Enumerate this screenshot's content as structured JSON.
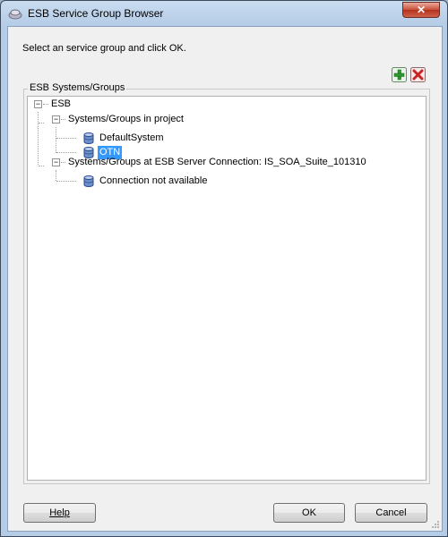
{
  "window": {
    "title": "ESB Service Group Browser",
    "close_symbol": "✕",
    "title_icon": "esb-app-icon"
  },
  "dialog": {
    "instruction": "Select an service group and click OK.",
    "add_icon": "add-icon",
    "delete_icon": "delete-icon",
    "group_label": "ESB Systems/Groups"
  },
  "tree": {
    "root": {
      "label": "ESB",
      "expanded": true
    },
    "project": {
      "label": "Systems/Groups in project",
      "expanded": true,
      "items": [
        "DefaultSystem",
        "OTN"
      ],
      "selected": "OTN"
    },
    "server": {
      "label": "Systems/Groups at ESB Server Connection: IS_SOA_Suite_101310",
      "expanded": true,
      "items": [
        "Connection not available"
      ]
    },
    "expander_symbol": "−"
  },
  "buttons": {
    "help": "Help",
    "ok": "OK",
    "cancel": "Cancel"
  },
  "colors": {
    "selection": "#3399ff",
    "add_green": "#2e9a2e",
    "delete_red": "#cc2222"
  }
}
